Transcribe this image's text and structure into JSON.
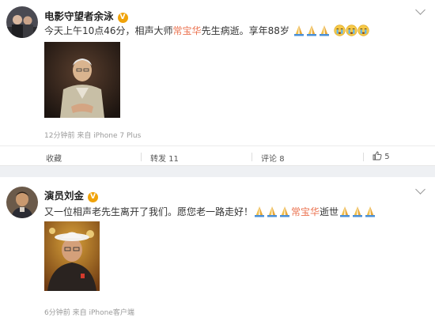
{
  "posts": [
    {
      "author": "电影守望者余泳",
      "verified_badge": "V",
      "text_before": "今天上午10点46分，相声大师",
      "highlight": "常宝华",
      "text_after": "先生病逝。享年88岁",
      "emoji_prayer_count": 3,
      "emoji_cry_count": 3,
      "meta": "12分钟前 来自 iPhone 7 Plus",
      "actions": {
        "favorite_label": "收藏",
        "repost_label": "转发",
        "repost_count": "11",
        "comment_label": "评论",
        "comment_count": "8",
        "like_count": "5"
      }
    },
    {
      "author": "演员刘金",
      "verified_badge": "V",
      "text_before": "又一位相声老先生离开了我们。愿您老一路走好！",
      "highlight": "常宝华",
      "text_after": "逝世",
      "emoji_prayer_before_count": 3,
      "emoji_prayer_after_count": 3,
      "meta": "6分钟前 来自 iPhone客户端"
    }
  ],
  "icons": {
    "verified": "verified-badge-icon",
    "dropdown": "chevron-down-icon",
    "like": "thumbs-up-icon",
    "prayer": "prayer-emoji-icon",
    "cry": "crying-emoji-icon"
  },
  "colors": {
    "highlight": "#eb7350",
    "badge": "#f0a30a",
    "meta_text": "#9a9a9a",
    "background": "#eef0f3"
  }
}
